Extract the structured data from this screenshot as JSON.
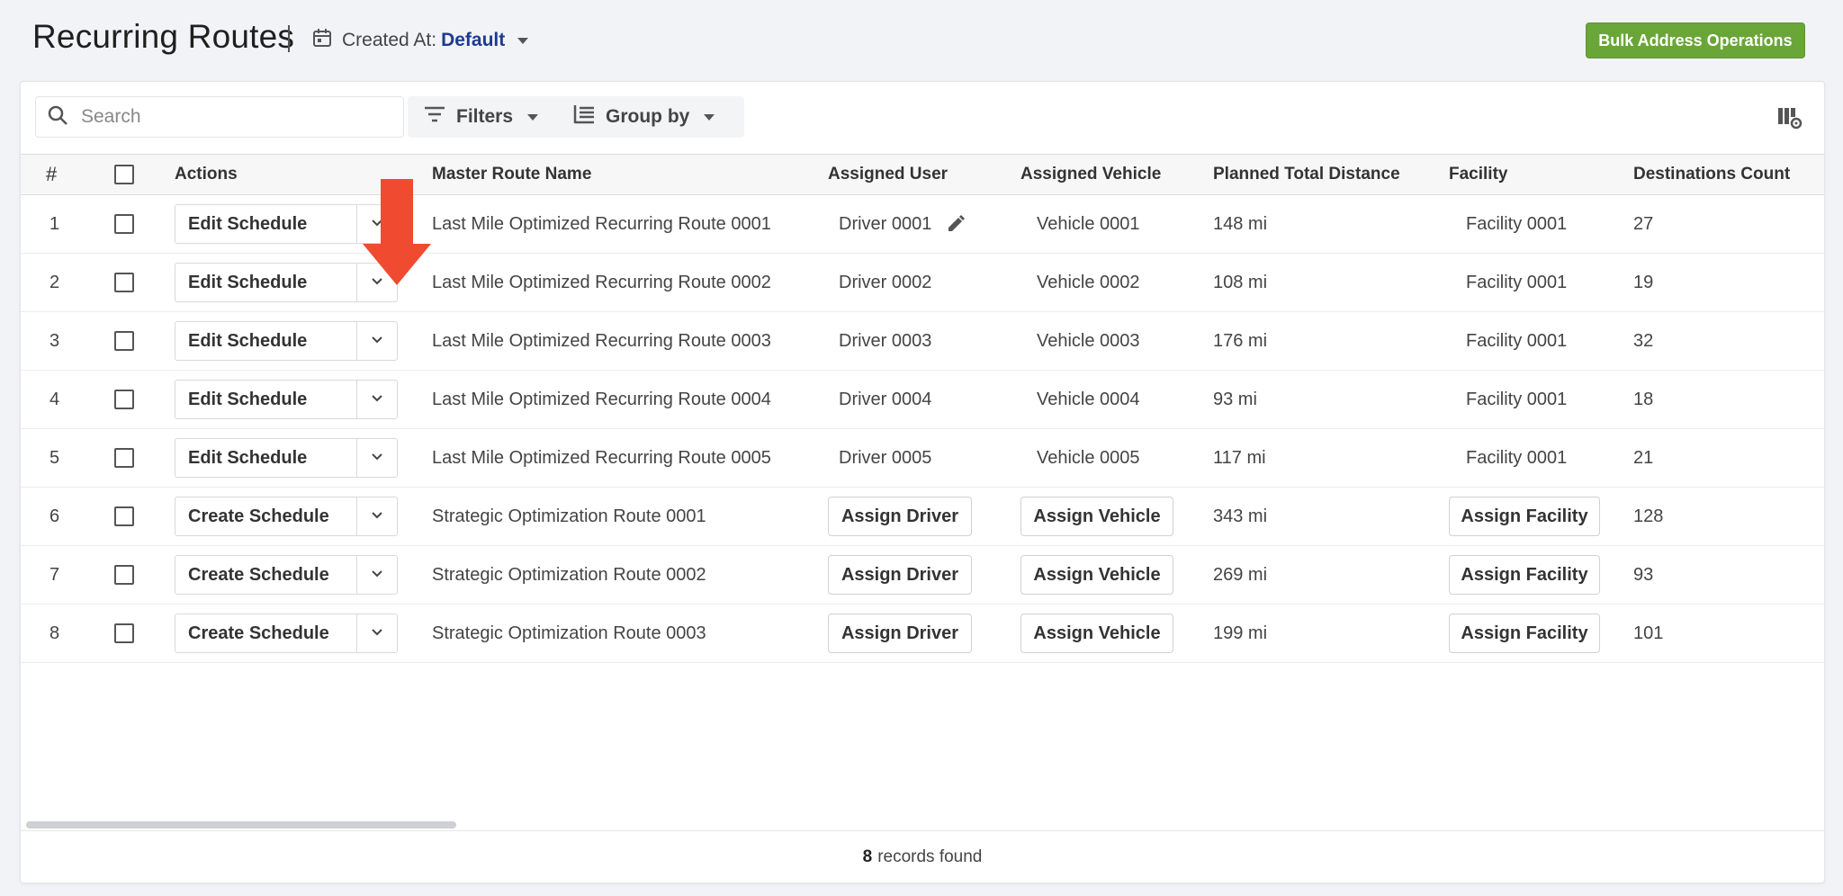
{
  "header": {
    "title": "Recurring Routes",
    "created_at_label": "Created At:",
    "created_at_value": "Default",
    "bulk_button": "Bulk Address Operations"
  },
  "toolbar": {
    "search_placeholder": "Search",
    "filters_label": "Filters",
    "group_by_label": "Group by"
  },
  "table": {
    "columns": [
      "#",
      "Actions",
      "Master Route Name",
      "Assigned User",
      "Assigned Vehicle",
      "Planned Total Distance",
      "Facility",
      "Destinations Count"
    ],
    "rows": [
      {
        "num": "1",
        "action": "Edit Schedule",
        "name": "Last Mile Optimized Recurring Route 0001",
        "user": "Driver 0001",
        "vehicle": "Vehicle 0001",
        "distance": "148 mi",
        "facility": "Facility 0001",
        "count": "27"
      },
      {
        "num": "2",
        "action": "Edit Schedule",
        "name": "Last Mile Optimized Recurring Route 0002",
        "user": "Driver 0002",
        "vehicle": "Vehicle 0002",
        "distance": "108 mi",
        "facility": "Facility 0001",
        "count": "19"
      },
      {
        "num": "3",
        "action": "Edit Schedule",
        "name": "Last Mile Optimized Recurring Route 0003",
        "user": "Driver 0003",
        "vehicle": "Vehicle 0003",
        "distance": "176 mi",
        "facility": "Facility 0001",
        "count": "32"
      },
      {
        "num": "4",
        "action": "Edit Schedule",
        "name": "Last Mile Optimized Recurring Route 0004",
        "user": "Driver 0004",
        "vehicle": "Vehicle 0004",
        "distance": "93 mi",
        "facility": "Facility 0001",
        "count": "18"
      },
      {
        "num": "5",
        "action": "Edit Schedule",
        "name": "Last Mile Optimized Recurring Route 0005",
        "user": "Driver 0005",
        "vehicle": "Vehicle 0005",
        "distance": "117 mi",
        "facility": "Facility 0001",
        "count": "21"
      },
      {
        "num": "6",
        "action": "Create Schedule",
        "name": "Strategic Optimization Route 0001",
        "user": "Assign Driver",
        "vehicle": "Assign Vehicle",
        "distance": "343 mi",
        "facility": "Assign Facility",
        "count": "128"
      },
      {
        "num": "7",
        "action": "Create Schedule",
        "name": "Strategic Optimization Route 0002",
        "user": "Assign Driver",
        "vehicle": "Assign Vehicle",
        "distance": "269 mi",
        "facility": "Assign Facility",
        "count": "93"
      },
      {
        "num": "8",
        "action": "Create Schedule",
        "name": "Strategic Optimization Route 0003",
        "user": "Assign Driver",
        "vehicle": "Assign Vehicle",
        "distance": "199 mi",
        "facility": "Assign Facility",
        "count": "101"
      }
    ]
  },
  "footer": {
    "count": "8",
    "label": "records found"
  },
  "colors": {
    "accent_green": "#6aa637",
    "link_blue": "#1f3a8f",
    "annotation_red": "#f04a30"
  },
  "icons": {
    "calendar": "calendar-icon",
    "search": "search-icon",
    "filters": "filter-icon",
    "group_by": "group-by-icon",
    "columns": "column-settings-icon",
    "edit": "pencil-icon",
    "annotation": "red-arrow-icon"
  }
}
